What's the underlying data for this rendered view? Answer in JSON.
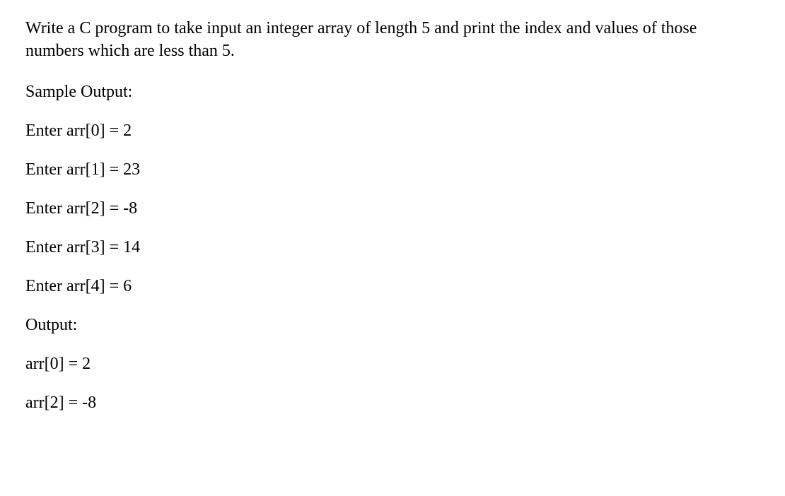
{
  "prompt": "Write a C program to take input an integer array of length 5 and print the index and values of those numbers which are less than 5.",
  "sample_output_label": "Sample Output:",
  "inputs": [
    "Enter arr[0] = 2",
    "Enter arr[1] = 23",
    "Enter arr[2] = -8",
    "Enter arr[3] = 14",
    "Enter arr[4] = 6"
  ],
  "output_label": "Output:",
  "outputs": [
    "arr[0] = 2",
    "arr[2] = -8"
  ]
}
